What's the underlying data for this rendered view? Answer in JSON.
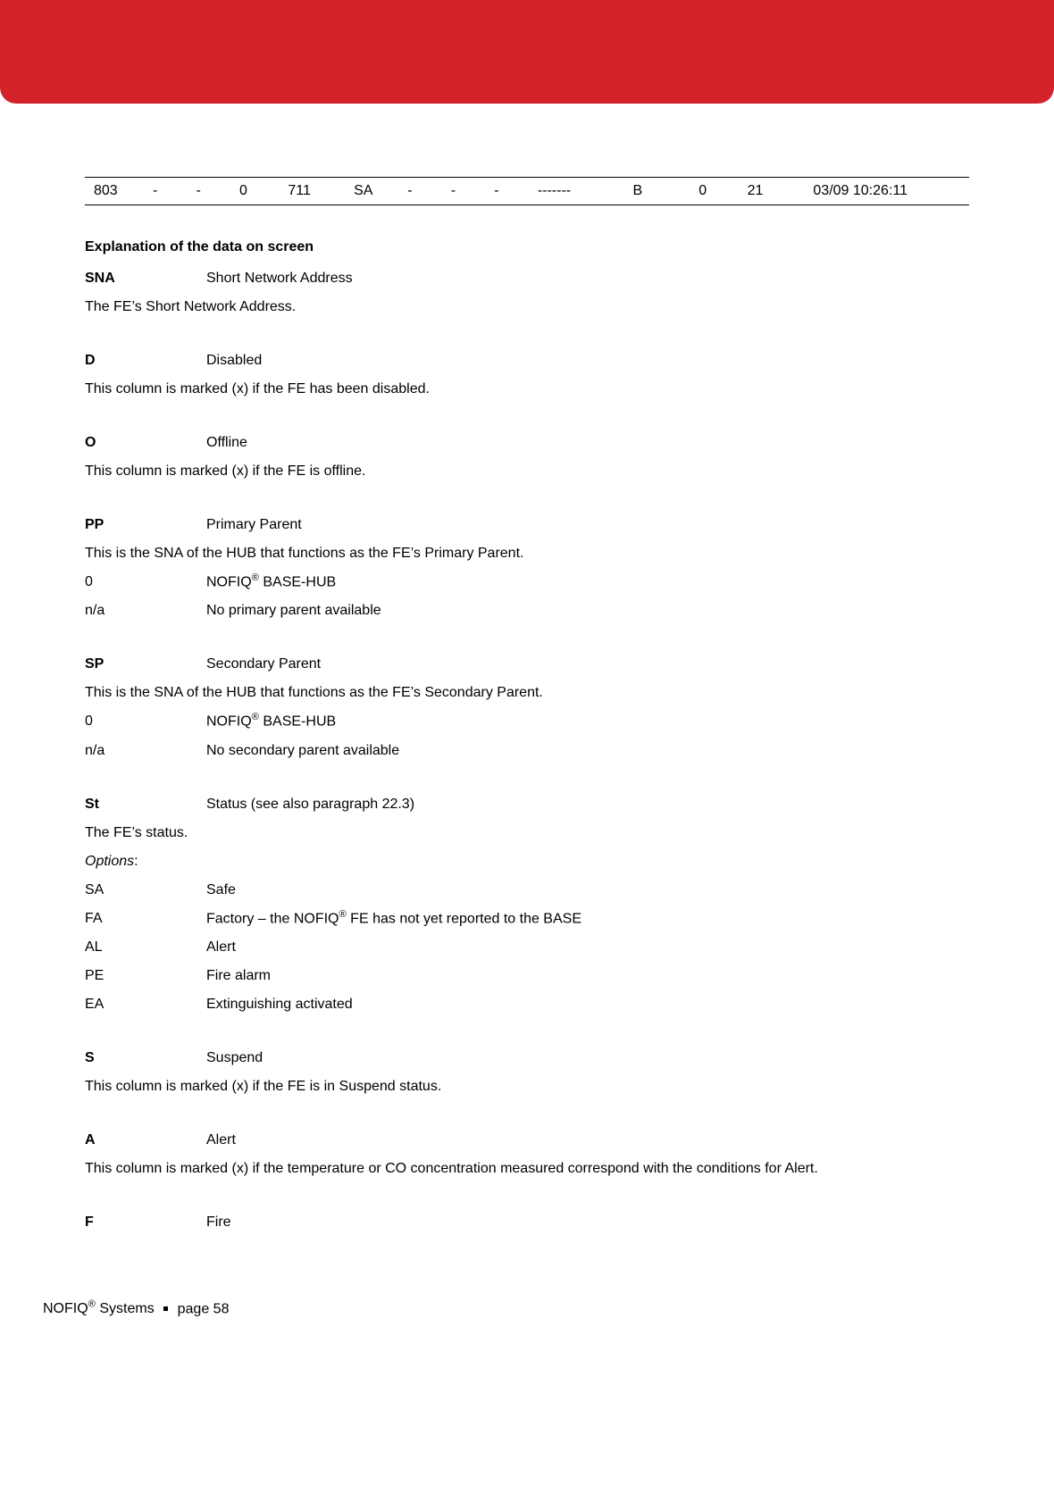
{
  "datarow": {
    "c1": "803",
    "c2": "-",
    "c3": "-",
    "c4": "0",
    "c5": "711",
    "c6": "SA",
    "c7": "-",
    "c8": "-",
    "c9": "-",
    "c10": "-------",
    "c11": "B",
    "c12": "0",
    "c13": "21",
    "c14": "03/09 10:26:11"
  },
  "sectionTitle": "Explanation of the data on screen",
  "sna": {
    "abbr": "SNA",
    "name": "Short Network Address",
    "desc": "The FE’s Short Network Address."
  },
  "d": {
    "abbr": "D",
    "name": "Disabled",
    "desc": "This column is marked (x) if the FE has been disabled."
  },
  "o": {
    "abbr": "O",
    "name": "Offline",
    "desc": "This column is marked (x) if the FE is offline."
  },
  "pp": {
    "abbr": "PP",
    "name": "Primary Parent",
    "desc": "This is the SNA of the HUB that functions as the FE’s Primary Parent.",
    "opt0_key": "0",
    "opt0_val_pre": "NOFIQ",
    "opt0_val_post": " BASE-HUB",
    "opt1_key": "n/a",
    "opt1_val": "No primary parent available"
  },
  "sp": {
    "abbr": "SP",
    "name": "Secondary Parent",
    "desc": "This is the SNA of the HUB that functions as the FE’s Secondary Parent.",
    "opt0_key": "0",
    "opt0_val_pre": "NOFIQ",
    "opt0_val_post": " BASE-HUB",
    "opt1_key": "n/a",
    "opt1_val": "No secondary parent available"
  },
  "st": {
    "abbr": "St",
    "name": "Status (see also paragraph 22.3)",
    "desc": "The FE’s status.",
    "optionsLabel": "Options",
    "sa_k": "SA",
    "sa_v": "Safe",
    "fa_k": "FA",
    "fa_v_pre": "Factory  – the NOFIQ",
    "fa_v_post": " FE has not yet reported to the BASE",
    "al_k": "AL",
    "al_v": "Alert",
    "pe_k": "PE",
    "pe_v": "Fire alarm",
    "ea_k": "EA",
    "ea_v": "Extinguishing activated"
  },
  "s": {
    "abbr": "S",
    "name": "Suspend",
    "desc": "This column is marked (x) if the FE is in Suspend status."
  },
  "a": {
    "abbr": "A",
    "name": "Alert",
    "desc": "This column is marked (x) if the temperature or CO concentration measured correspond with the conditions for Alert."
  },
  "f": {
    "abbr": "F",
    "name": "Fire"
  },
  "footer": {
    "brand_pre": "NOFIQ",
    "brand_post": " Systems",
    "page": "page 58"
  }
}
